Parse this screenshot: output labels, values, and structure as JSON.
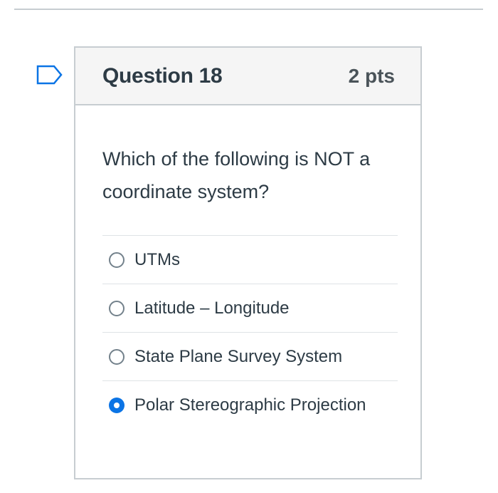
{
  "question": {
    "title": "Question 18",
    "points": "2 pts",
    "text": "Which of the following is NOT a coordinate system?",
    "answers": [
      {
        "label": "UTMs",
        "selected": false
      },
      {
        "label": "Latitude – Longitude",
        "selected": false
      },
      {
        "label": "State Plane Survey System",
        "selected": false
      },
      {
        "label": "Polar Stereographic Projection",
        "selected": true
      }
    ]
  },
  "colors": {
    "accent": "#0b74e5",
    "flag": "#0b74e5",
    "border": "#c7cdd1",
    "header_bg": "#f5f5f5"
  },
  "icons": {
    "flag": "flag-outline-icon"
  }
}
